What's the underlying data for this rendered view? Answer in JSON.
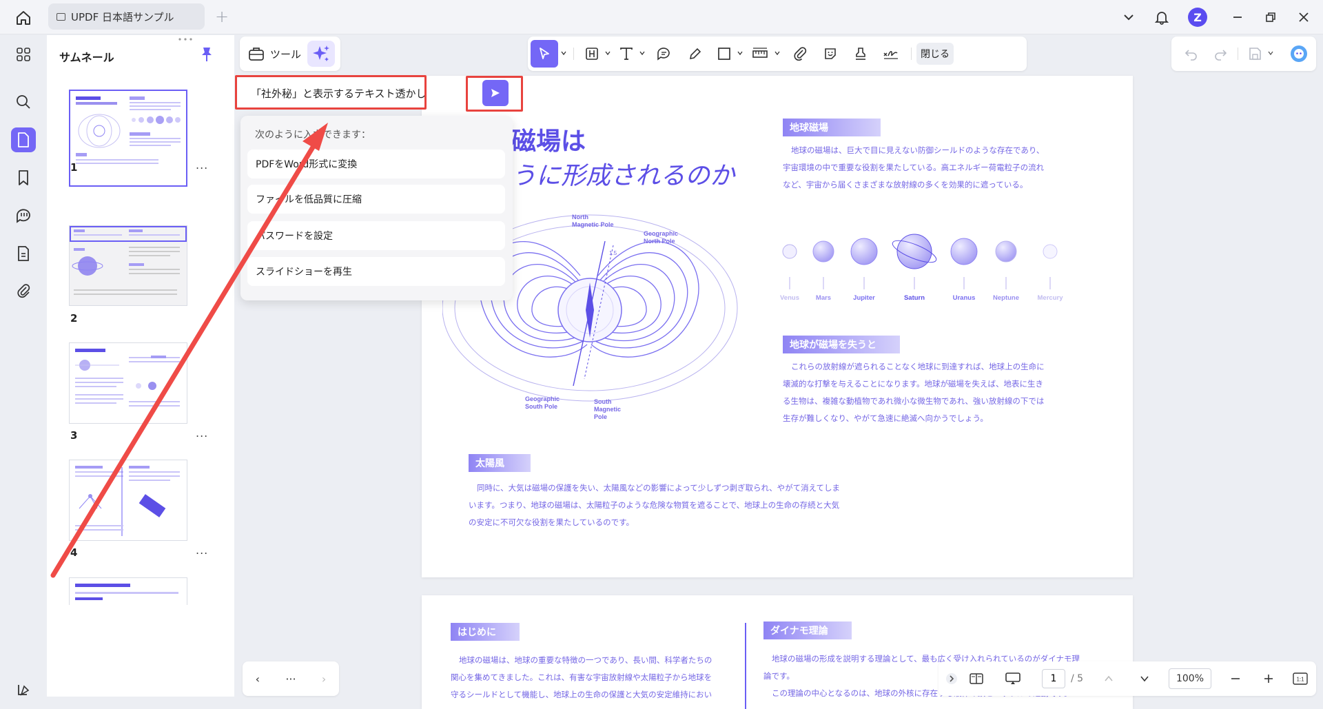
{
  "titlebar": {
    "tab_title": "UPDF 日本語サンプル",
    "avatar_letter": "Z"
  },
  "sidebar": {
    "title": "サムネール"
  },
  "thumbnails": [
    {
      "number": "1",
      "more": "..."
    },
    {
      "number": "2",
      "more": "..."
    },
    {
      "number": "3",
      "more": "..."
    },
    {
      "number": "4",
      "more": "..."
    }
  ],
  "toolbar": {
    "tools_label": "ツール",
    "close_label": "閉じる"
  },
  "ai_prompt": {
    "value": "「社外秘」と表示するテキスト透かし"
  },
  "suggestions": {
    "title": "次のように入力できます：",
    "items": [
      "PDFをWord形式に変換",
      "ファイルを低品質に圧縮",
      "パスワードを設定",
      "スライドショーを再生"
    ]
  },
  "page1": {
    "title_line1": "地球の磁場は",
    "title_line2": "どのように形成されるのか",
    "sec_earth_field": "地球磁場",
    "para_earth_field": [
      "地球の磁場は、巨大で目に見えない防御シールドのような存在であり、",
      "宇宙環境の中で重要な役割を果たしている。高エネルギー荷電粒子の流れ",
      "など、宇宙から届くさまざまな放射線の多くを効果的に遮っている。"
    ],
    "diagram_labels": {
      "north_magnetic": [
        "North",
        "Magnetic Pole"
      ],
      "geo_north": [
        "Geographic",
        "North Pole"
      ],
      "angle": "1.5",
      "geo_south": [
        "Geographic",
        "South Pole"
      ],
      "south_magnetic": [
        "South",
        "Magnetic",
        "Pole"
      ]
    },
    "planets": [
      "Venus",
      "Mars",
      "Jupiter",
      "Saturn",
      "Uranus",
      "Neptune",
      "Mercury"
    ],
    "sec_lose_field": "地球が磁場を失うと",
    "para_lose_field": [
      "これらの放射線が遮られることなく地球に到達すれば、地球上の生命に",
      "壊滅的な打撃を与えることになります。地球が磁場を失えば、地表に生き",
      "る生物は、複雑な動植物であれ微小な微生物であれ、強い放射線の下では",
      "生存が難しくなり、やがて急速に絶滅へ向かうでしょう。"
    ],
    "sec_solar_wind": "太陽風",
    "para_solar_wind": [
      "同時に、大気は磁場の保護を失い、太陽風などの影響によって少しずつ剥ぎ取られ、やがて消えてしま",
      "います。つまり、地球の磁場は、太陽粒子のような危険な物質を遮ることで、地球上の生命の存続と大気",
      "の安定に不可欠な役割を果たしているのです。"
    ]
  },
  "page2": {
    "sec_intro": "はじめに",
    "para_intro": [
      "地球の磁場は、地球の重要な特徴の一つであり、長い間、科学者たちの",
      "関心を集めてきました。これは、有害な宇宙放射線や太陽粒子から地球を",
      "守るシールドとして機能し、地球上の生命の保護と大気の安定維持におい"
    ],
    "sec_dynamo": "ダイナモ理論",
    "para_dynamo": [
      "地球の磁場の形成を説明する理論として、最も広く受け入れられているのがダイナモ理",
      "論です。",
      "この理論の中心となるのは、地球の外核に存在する液体の鉄とニッケルの運動です。"
    ]
  },
  "pagenav": {
    "prev": "‹",
    "more": "···",
    "next": "›"
  },
  "zoombar": {
    "current_page": "1",
    "total_pages": "/ 5",
    "zoom": "100%"
  },
  "colors": {
    "accent": "#7467f6",
    "highlight": "#e8433e",
    "doc_text": "#7567e5"
  }
}
